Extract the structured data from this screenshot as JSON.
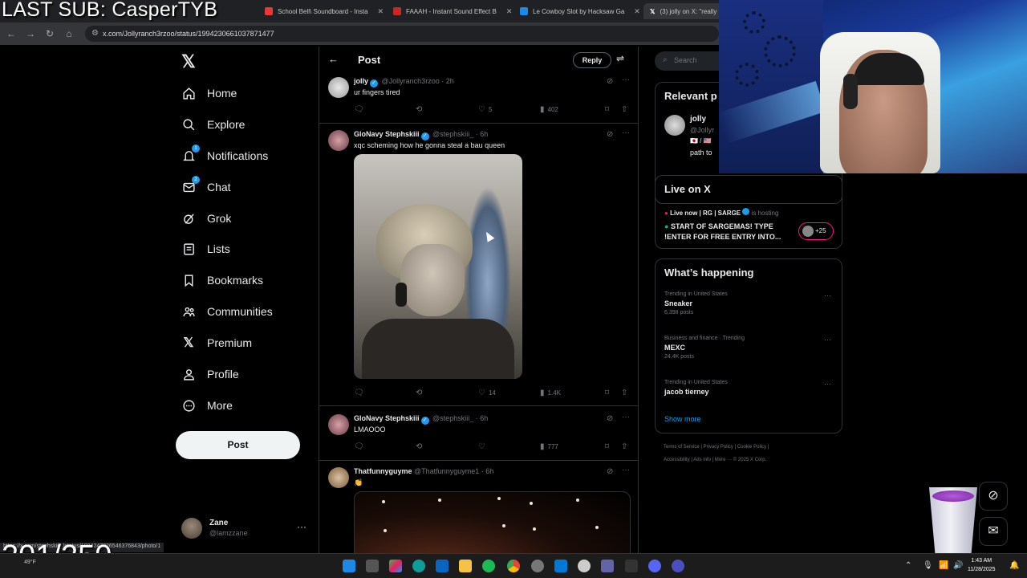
{
  "overlay": {
    "title": "LAST SUB: CasperTYB",
    "counter": "201/250"
  },
  "browser": {
    "tabs": [
      {
        "label": "School Bell\\ Soundboard - Insta",
        "color": "#e53935"
      },
      {
        "label": "FAAAH - Instant Sound Effect B",
        "color": "#c62828"
      },
      {
        "label": "Le Cowboy Slot by Hacksaw Ga",
        "color": "#1e88e5"
      },
      {
        "label": "(3) jolly on X: \"really",
        "color": "#ffffff"
      }
    ],
    "url": "x.com/Jollyranch3rzoo/status/1994230661037871477",
    "status_url": "https://x.com/stephskiii_/status/1994247226546376843/photo/1"
  },
  "nav": {
    "items": [
      {
        "label": "Home",
        "icon": "home-icon"
      },
      {
        "label": "Explore",
        "icon": "search-icon"
      },
      {
        "label": "Notifications",
        "icon": "bell-icon",
        "badge": "1"
      },
      {
        "label": "Chat",
        "icon": "mail-icon",
        "badge": "2"
      },
      {
        "label": "Grok",
        "icon": "grok-icon"
      },
      {
        "label": "Lists",
        "icon": "list-icon"
      },
      {
        "label": "Bookmarks",
        "icon": "bookmark-icon"
      },
      {
        "label": "Communities",
        "icon": "people-icon"
      },
      {
        "label": "Premium",
        "icon": "x-logo-icon"
      },
      {
        "label": "Profile",
        "icon": "person-icon"
      },
      {
        "label": "More",
        "icon": "more-circle-icon"
      }
    ],
    "post_label": "Post",
    "account": {
      "name": "Zane",
      "handle": "@lamzzane"
    }
  },
  "main": {
    "title": "Post",
    "reply_label": "Reply",
    "tweets": [
      {
        "name": "jolly",
        "handle": "@Jollyranch3rzoo",
        "time": "2h",
        "text": "ur fingers tired",
        "likes": "5",
        "views": "402"
      },
      {
        "name": "GloNavy Stephskiii",
        "handle": "@stephskiii_",
        "time": "6h",
        "text": "xqc scheming how he gonna steal a bau queen",
        "likes": "14",
        "views": "1.4K"
      },
      {
        "name": "GloNavy Stephskiii",
        "handle": "@stephskiii_",
        "time": "6h",
        "text": "LMAOOO",
        "likes": "",
        "views": "777"
      },
      {
        "name": "Thatfunnyguyme",
        "handle": "@Thatfunnyguyme1",
        "time": "6h",
        "text": "👏"
      }
    ]
  },
  "sidebar": {
    "search_placeholder": "Search",
    "relevant": {
      "title": "Relevant p",
      "name": "jolly",
      "handle": "@Jollyr",
      "flags": "🇯🇵 / 🇺🇸",
      "bio": "path to"
    },
    "live": {
      "title": "Live on X",
      "host_line": "Live now | RG | SARGE",
      "host_suffix": "is hosting",
      "stream_title_1": "START OF SARGEMAS! TYPE",
      "stream_title_2": "!ENTER FOR FREE ENTRY INTO...",
      "extra": "+25"
    },
    "happening": {
      "title": "What’s happening",
      "trends": [
        {
          "category": "Trending in United States",
          "name": "Sneaker",
          "count": "6,398 posts"
        },
        {
          "category": "Business and finance · Trending",
          "name": "MEXC",
          "count": "24.4K posts"
        },
        {
          "category": "Trending in United States",
          "name": "jacob tierney",
          "count": ""
        }
      ],
      "show_more": "Show more"
    },
    "footer_1": "Terms of Service  |  Privacy Policy  |  Cookie Policy  |",
    "footer_2": "Accessibility  |  Ads info  |  More ···  © 2025 X Corp."
  },
  "taskbar": {
    "time": "1:43 AM",
    "date": "11/28/2025",
    "weather": "49°F"
  },
  "colors": {
    "accent": "#1d9bf0",
    "background": "#000000",
    "border": "#2f3336",
    "muted": "#71767b"
  }
}
